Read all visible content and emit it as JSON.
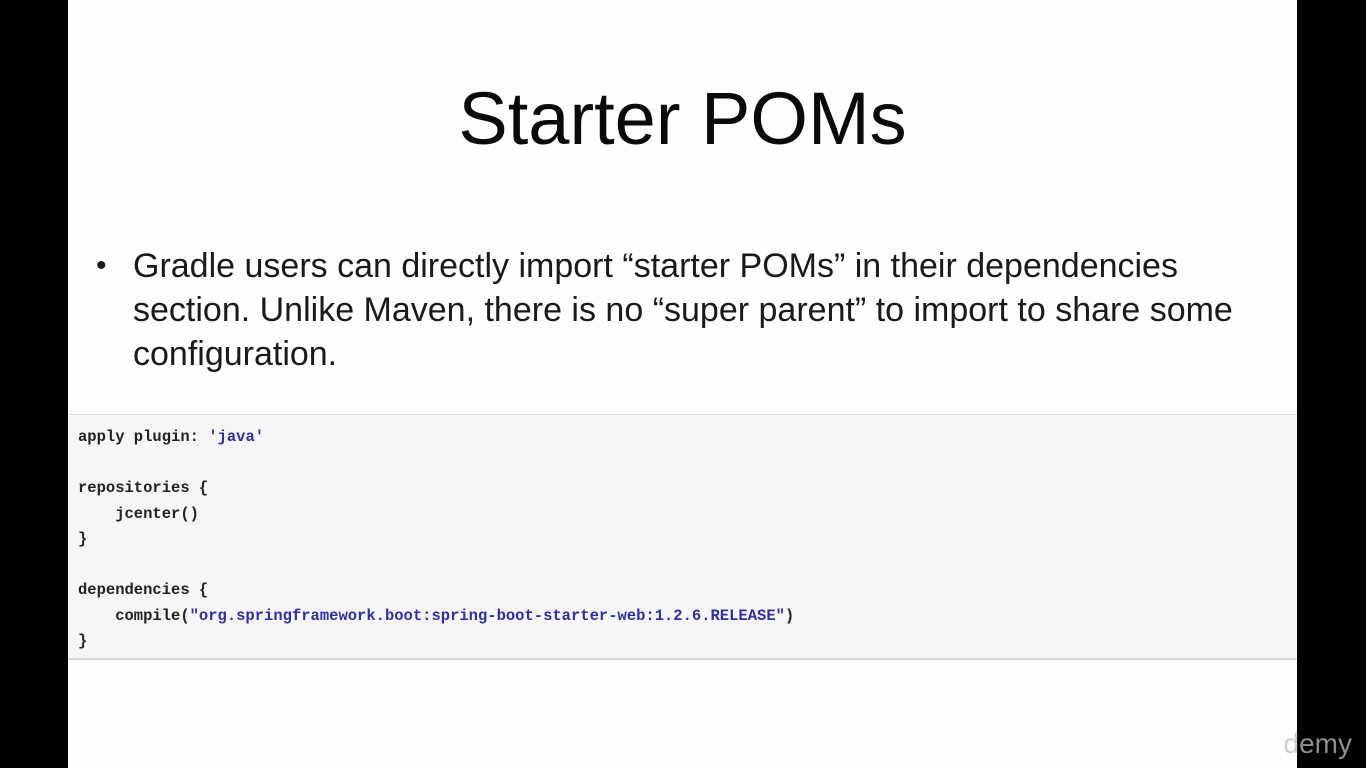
{
  "slide": {
    "title": "Starter POMs",
    "bullets": [
      {
        "marker": "•",
        "text": "Gradle users can directly import “starter POMs” in their dependencies section. Unlike Maven, there is no “super parent” to import to share some configuration."
      }
    ],
    "code": {
      "lines": [
        {
          "plain": "apply plugin: ",
          "string": "'java'",
          "suffix": ""
        },
        {
          "plain": "",
          "string": "",
          "suffix": ""
        },
        {
          "plain": "repositories {",
          "string": "",
          "suffix": ""
        },
        {
          "plain": "    jcenter()",
          "string": "",
          "suffix": ""
        },
        {
          "plain": "}",
          "string": "",
          "suffix": ""
        },
        {
          "plain": "",
          "string": "",
          "suffix": ""
        },
        {
          "plain": "dependencies {",
          "string": "",
          "suffix": ""
        },
        {
          "plain": "    compile(",
          "string": "\"org.springframework.boot:spring-boot-starter-web:1.2.6.RELEASE\"",
          "suffix": ")"
        },
        {
          "plain": "}",
          "string": "",
          "suffix": ""
        }
      ]
    },
    "watermark": "demy"
  },
  "colors": {
    "background": "#fefefe",
    "letterbox": "#000000",
    "code_background": "#f6f6f8",
    "code_string": "#2f2fa0"
  }
}
